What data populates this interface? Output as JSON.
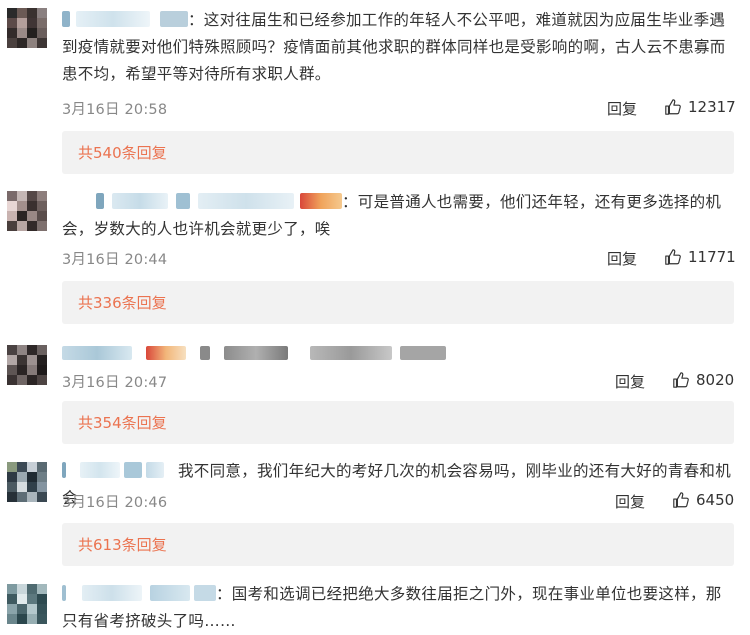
{
  "comments": [
    {
      "text": "：这对往届生和已经参加工作的年轻人不公平吧，难道就因为应届生毕业季遇到疫情就要对他们特殊照顾吗？疫情面前其他求职的群体同样也是受影响的啊，古人云不患寡而患不均，希望平等对待所有求职人群。",
      "time": "3月16日 20:58",
      "reply_label": "回复",
      "likes": "12317",
      "replies_label": "共540条回复"
    },
    {
      "text": "：可是普通人也需要，他们还年轻，还有更多选择的机会，岁数大的人也许机会就更少了，唉",
      "time": "3月16日 20:44",
      "reply_label": "回复",
      "likes": "11771",
      "replies_label": "共336条回复"
    },
    {
      "text": "",
      "time": "3月16日 20:47",
      "reply_label": "回复",
      "likes": "8020",
      "replies_label": "共354条回复"
    },
    {
      "text": "我不同意，我们年纪大的考好几次的机会容易吗，刚毕业的还有大好的青春和机会",
      "time": "3月16日 20:46",
      "reply_label": "回复",
      "likes": "6450",
      "replies_label": "共613条回复"
    },
    {
      "text": "：国考和选调已经把绝大多数往届拒之门外，现在事业单位也要这样，那只有省考挤破头了吗……",
      "time": "",
      "reply_label": "",
      "likes": "",
      "replies_label": ""
    }
  ],
  "colors": {
    "accent": "#eb7350",
    "muted": "#888888",
    "text": "#333333",
    "reply_box": "#f2f2f2"
  },
  "icons": {
    "like": "thumbs-up-icon"
  }
}
